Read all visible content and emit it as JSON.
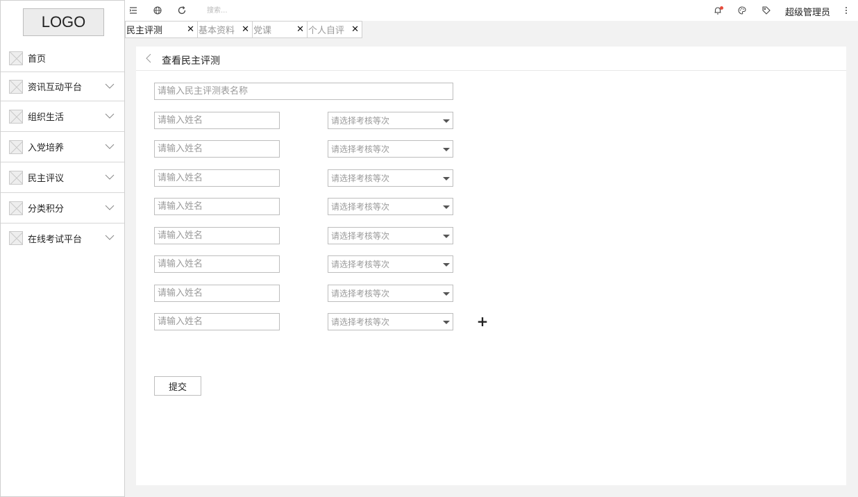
{
  "logo": {
    "text": "LOGO"
  },
  "sidebar": {
    "items": [
      {
        "label": "首页",
        "expandable": false
      },
      {
        "label": "资讯互动平台",
        "expandable": true
      },
      {
        "label": "组织生活",
        "expandable": true
      },
      {
        "label": "入党培养",
        "expandable": true
      },
      {
        "label": "民主评议",
        "expandable": true
      },
      {
        "label": "分类积分",
        "expandable": true
      },
      {
        "label": "在线考试平台",
        "expandable": true
      }
    ]
  },
  "topbar": {
    "search_placeholder": "搜索...",
    "user_name": "超级管理员",
    "icons": [
      "menu-fold-icon",
      "globe-icon",
      "refresh-icon",
      "bell-icon",
      "palette-icon",
      "tag-icon",
      "more-vertical-icon"
    ],
    "notification_color": "#e74c3c"
  },
  "tabs": [
    {
      "label": "民主评测",
      "active": true
    },
    {
      "label": "基本资料",
      "active": false
    },
    {
      "label": "党课",
      "active": false
    },
    {
      "label": "个人自评",
      "active": false
    }
  ],
  "page": {
    "title": "查看民主评测",
    "form_name_placeholder": "请输入民主评测表名称",
    "name_placeholder": "请输入姓名",
    "grade_placeholder": "请选择考核等次",
    "add_label": "+",
    "submit_label": "提交"
  }
}
